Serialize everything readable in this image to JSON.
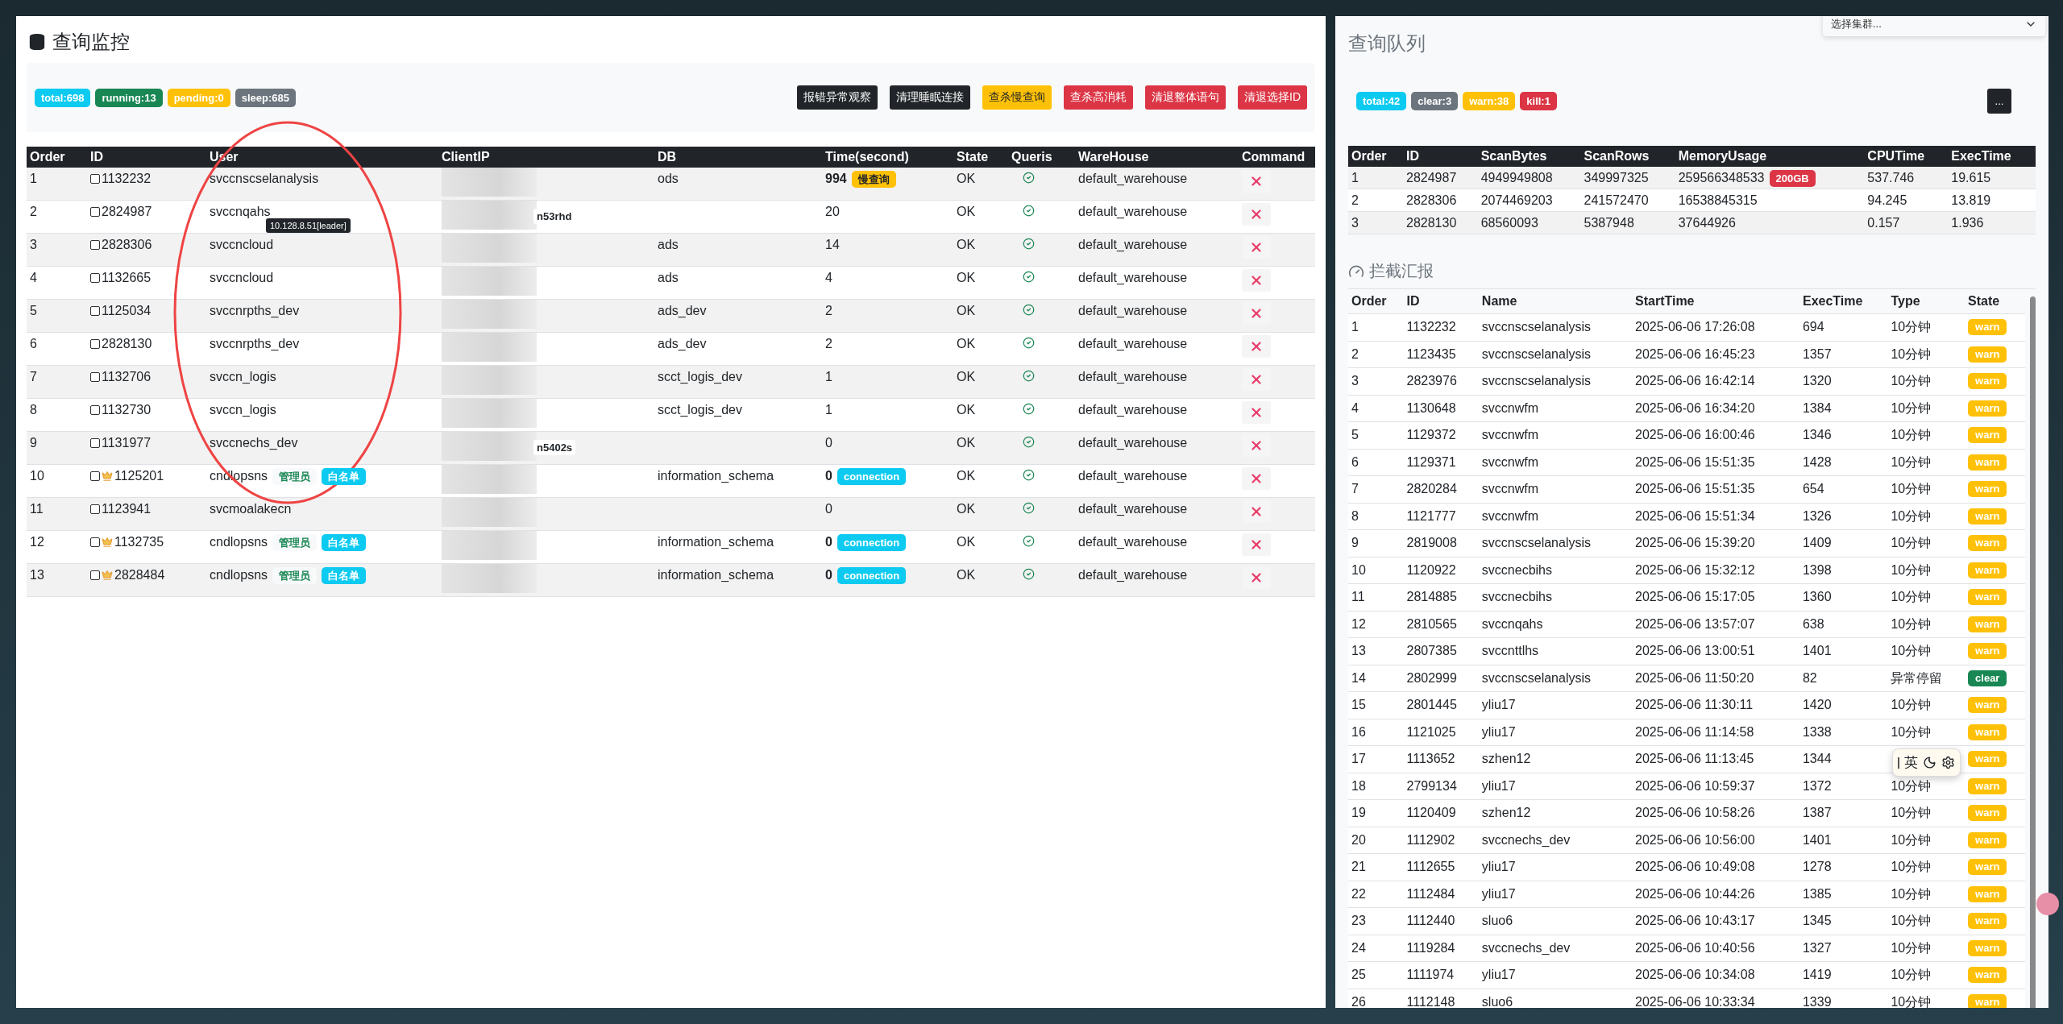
{
  "cluster_select": {
    "placeholder": "选择集群..."
  },
  "monitor": {
    "title": "查询监控",
    "stats": [
      {
        "label": "total:698",
        "kind": "info"
      },
      {
        "label": "running:13",
        "kind": "success"
      },
      {
        "label": "pending:0",
        "kind": "warning"
      },
      {
        "label": "sleep:685",
        "kind": "secondary"
      }
    ],
    "actions": [
      {
        "label": "报错异常观察",
        "kind": "dark"
      },
      {
        "label": "清理睡眠连接",
        "kind": "dark"
      },
      {
        "label": "查杀慢查询",
        "kind": "warning"
      },
      {
        "label": "查杀高消耗",
        "kind": "danger"
      },
      {
        "label": "清退整体语句",
        "kind": "danger"
      },
      {
        "label": "清退选择ID",
        "kind": "danger"
      }
    ],
    "columns": [
      "Order",
      "ID",
      "User",
      "ClientIP",
      "DB",
      "Time(second)",
      "State",
      "Queris",
      "WareHouse",
      "Command"
    ],
    "rows": [
      {
        "order": "1",
        "id": "1132232",
        "checked": false,
        "vip": false,
        "user": "svccnscselanalysis",
        "ip_fragment": null,
        "db": "ods",
        "time": "994",
        "time_tag": {
          "label": "慢查询",
          "kind": "warning"
        },
        "state": "OK",
        "warehouse": "default_warehouse"
      },
      {
        "order": "2",
        "id": "2824987",
        "checked": false,
        "vip": false,
        "user": "svccnqahs",
        "tooltip": "10.128.8.51[leader]",
        "ip_fragment": "n53rhd",
        "db": "",
        "time": "20",
        "state": "OK",
        "warehouse": "default_warehouse"
      },
      {
        "order": "3",
        "id": "2828306",
        "checked": false,
        "vip": false,
        "user": "svccncloud",
        "db": "ads",
        "time": "14",
        "state": "OK",
        "warehouse": "default_warehouse"
      },
      {
        "order": "4",
        "id": "1132665",
        "checked": false,
        "vip": false,
        "user": "svccncloud",
        "db": "ads",
        "time": "4",
        "state": "OK",
        "warehouse": "default_warehouse"
      },
      {
        "order": "5",
        "id": "1125034",
        "checked": false,
        "vip": false,
        "user": "svccnrpths_dev",
        "db": "ads_dev",
        "time": "2",
        "state": "OK",
        "warehouse": "default_warehouse"
      },
      {
        "order": "6",
        "id": "2828130",
        "checked": false,
        "vip": false,
        "user": "svccnrpths_dev",
        "db": "ads_dev",
        "time": "2",
        "state": "OK",
        "warehouse": "default_warehouse"
      },
      {
        "order": "7",
        "id": "1132706",
        "checked": false,
        "vip": false,
        "user": "svccn_logis",
        "db": "scct_logis_dev",
        "time": "1",
        "state": "OK",
        "warehouse": "default_warehouse"
      },
      {
        "order": "8",
        "id": "1132730",
        "checked": false,
        "vip": false,
        "user": "svccn_logis",
        "db": "scct_logis_dev",
        "time": "1",
        "state": "OK",
        "warehouse": "default_warehouse"
      },
      {
        "order": "9",
        "id": "1131977",
        "checked": false,
        "vip": false,
        "user": "svccnechs_dev",
        "ip_fragment": "n5402s",
        "db": "",
        "time": "0",
        "state": "OK",
        "warehouse": "default_warehouse"
      },
      {
        "order": "10",
        "id": "1125201",
        "checked": false,
        "vip": true,
        "user": "cndlopsns",
        "tags": [
          {
            "label": "管理员",
            "kind": "light"
          },
          {
            "label": "白名单",
            "kind": "info"
          }
        ],
        "db": "information_schema",
        "time": "0",
        "time_tag": {
          "label": "connection",
          "kind": "info"
        },
        "state": "OK",
        "warehouse": "default_warehouse"
      },
      {
        "order": "11",
        "id": "1123941",
        "checked": false,
        "vip": false,
        "user": "svcmoalakecn",
        "db": "",
        "time": "0",
        "state": "OK",
        "warehouse": "default_warehouse"
      },
      {
        "order": "12",
        "id": "1132735",
        "checked": false,
        "vip": true,
        "user": "cndlopsns",
        "tags": [
          {
            "label": "管理员",
            "kind": "light"
          },
          {
            "label": "白名单",
            "kind": "info"
          }
        ],
        "db": "information_schema",
        "time": "0",
        "time_tag": {
          "label": "connection",
          "kind": "info"
        },
        "state": "OK",
        "warehouse": "default_warehouse"
      },
      {
        "order": "13",
        "id": "2828484",
        "checked": false,
        "vip": true,
        "user": "cndlopsns",
        "tags": [
          {
            "label": "管理员",
            "kind": "light"
          },
          {
            "label": "白名单",
            "kind": "info"
          }
        ],
        "db": "information_schema",
        "time": "0",
        "time_tag": {
          "label": "connection",
          "kind": "info"
        },
        "state": "OK",
        "warehouse": "default_warehouse"
      }
    ]
  },
  "queue": {
    "title": "查询队列",
    "stats": [
      {
        "label": "total:42",
        "kind": "info"
      },
      {
        "label": "clear:3",
        "kind": "secondary"
      },
      {
        "label": "warn:38",
        "kind": "warning"
      },
      {
        "label": "kill:1",
        "kind": "danger"
      }
    ],
    "more_button": "...",
    "columns": [
      "Order",
      "ID",
      "ScanBytes",
      "ScanRows",
      "MemoryUsage",
      "CPUTime",
      "ExecTime"
    ],
    "rows": [
      {
        "cells": [
          "1",
          "2824987",
          "4949949808",
          "349997325",
          "259566348533",
          "537.746",
          "19.615"
        ],
        "memory_tag": "200GB"
      },
      {
        "cells": [
          "2",
          "2828306",
          "2074469203",
          "241572470",
          "16538845315",
          "94.245",
          "13.819"
        ]
      },
      {
        "cells": [
          "3",
          "2828130",
          "68560093",
          "5387948",
          "37644926",
          "0.157",
          "1.936"
        ]
      }
    ]
  },
  "intercept": {
    "title": "拦截汇报",
    "columns": [
      "Order",
      "ID",
      "Name",
      "StartTime",
      "ExecTime",
      "Type",
      "State"
    ],
    "rows": [
      {
        "cells": [
          "1",
          "1132232",
          "svccnscselanalysis",
          "2025-06-06 17:26:08",
          "694",
          "10分钟"
        ],
        "state": {
          "label": "warn",
          "kind": "warning"
        }
      },
      {
        "cells": [
          "2",
          "1123435",
          "svccnscselanalysis",
          "2025-06-06 16:45:23",
          "1357",
          "10分钟"
        ],
        "state": {
          "label": "warn",
          "kind": "warning"
        }
      },
      {
        "cells": [
          "3",
          "2823976",
          "svccnscselanalysis",
          "2025-06-06 16:42:14",
          "1320",
          "10分钟"
        ],
        "state": {
          "label": "warn",
          "kind": "warning"
        }
      },
      {
        "cells": [
          "4",
          "1130648",
          "svccnwfm",
          "2025-06-06 16:34:20",
          "1384",
          "10分钟"
        ],
        "state": {
          "label": "warn",
          "kind": "warning"
        }
      },
      {
        "cells": [
          "5",
          "1129372",
          "svccnwfm",
          "2025-06-06 16:00:46",
          "1346",
          "10分钟"
        ],
        "state": {
          "label": "warn",
          "kind": "warning"
        }
      },
      {
        "cells": [
          "6",
          "1129371",
          "svccnwfm",
          "2025-06-06 15:51:35",
          "1428",
          "10分钟"
        ],
        "state": {
          "label": "warn",
          "kind": "warning"
        }
      },
      {
        "cells": [
          "7",
          "2820284",
          "svccnwfm",
          "2025-06-06 15:51:35",
          "654",
          "10分钟"
        ],
        "state": {
          "label": "warn",
          "kind": "warning"
        }
      },
      {
        "cells": [
          "8",
          "1121777",
          "svccnwfm",
          "2025-06-06 15:51:34",
          "1326",
          "10分钟"
        ],
        "state": {
          "label": "warn",
          "kind": "warning"
        }
      },
      {
        "cells": [
          "9",
          "2819008",
          "svccnscselanalysis",
          "2025-06-06 15:39:20",
          "1409",
          "10分钟"
        ],
        "state": {
          "label": "warn",
          "kind": "warning"
        }
      },
      {
        "cells": [
          "10",
          "1120922",
          "svccnecbihs",
          "2025-06-06 15:32:12",
          "1398",
          "10分钟"
        ],
        "state": {
          "label": "warn",
          "kind": "warning"
        }
      },
      {
        "cells": [
          "11",
          "2814885",
          "svccnecbihs",
          "2025-06-06 15:17:05",
          "1360",
          "10分钟"
        ],
        "state": {
          "label": "warn",
          "kind": "warning"
        }
      },
      {
        "cells": [
          "12",
          "2810565",
          "svccnqahs",
          "2025-06-06 13:57:07",
          "638",
          "10分钟"
        ],
        "state": {
          "label": "warn",
          "kind": "warning"
        }
      },
      {
        "cells": [
          "13",
          "2807385",
          "svccnttlhs",
          "2025-06-06 13:00:51",
          "1401",
          "10分钟"
        ],
        "state": {
          "label": "warn",
          "kind": "warning"
        }
      },
      {
        "cells": [
          "14",
          "2802999",
          "svccnscselanalysis",
          "2025-06-06 11:50:20",
          "82",
          "异常停留"
        ],
        "state": {
          "label": "clear",
          "kind": "success"
        }
      },
      {
        "cells": [
          "15",
          "2801445",
          "yliu17",
          "2025-06-06 11:30:11",
          "1420",
          "10分钟"
        ],
        "state": {
          "label": "warn",
          "kind": "warning"
        }
      },
      {
        "cells": [
          "16",
          "1121025",
          "yliu17",
          "2025-06-06 11:14:58",
          "1338",
          "10分钟"
        ],
        "state": {
          "label": "warn",
          "kind": "warning"
        }
      },
      {
        "cells": [
          "17",
          "1113652",
          "szhen12",
          "2025-06-06 11:13:45",
          "1344",
          ""
        ],
        "state": {
          "label": "warn",
          "kind": "warning"
        }
      },
      {
        "cells": [
          "18",
          "2799134",
          "yliu17",
          "2025-06-06 10:59:37",
          "1372",
          "10分钟"
        ],
        "state": {
          "label": "warn",
          "kind": "warning"
        }
      },
      {
        "cells": [
          "19",
          "1120409",
          "szhen12",
          "2025-06-06 10:58:26",
          "1387",
          "10分钟"
        ],
        "state": {
          "label": "warn",
          "kind": "warning"
        }
      },
      {
        "cells": [
          "20",
          "1112902",
          "svccnechs_dev",
          "2025-06-06 10:56:00",
          "1401",
          "10分钟"
        ],
        "state": {
          "label": "warn",
          "kind": "warning"
        }
      },
      {
        "cells": [
          "21",
          "1112655",
          "yliu17",
          "2025-06-06 10:49:08",
          "1278",
          "10分钟"
        ],
        "state": {
          "label": "warn",
          "kind": "warning"
        }
      },
      {
        "cells": [
          "22",
          "1112484",
          "yliu17",
          "2025-06-06 10:44:26",
          "1385",
          "10分钟"
        ],
        "state": {
          "label": "warn",
          "kind": "warning"
        }
      },
      {
        "cells": [
          "23",
          "1112440",
          "sluo6",
          "2025-06-06 10:43:17",
          "1345",
          "10分钟"
        ],
        "state": {
          "label": "warn",
          "kind": "warning"
        }
      },
      {
        "cells": [
          "24",
          "1119284",
          "svccnechs_dev",
          "2025-06-06 10:40:56",
          "1327",
          "10分钟"
        ],
        "state": {
          "label": "warn",
          "kind": "warning"
        }
      },
      {
        "cells": [
          "25",
          "1111974",
          "yliu17",
          "2025-06-06 10:34:08",
          "1419",
          "10分钟"
        ],
        "state": {
          "label": "warn",
          "kind": "warning"
        }
      },
      {
        "cells": [
          "26",
          "1112148",
          "sluo6",
          "2025-06-06 10:33:34",
          "1339",
          "10分钟"
        ],
        "state": {
          "label": "warn",
          "kind": "warning"
        }
      }
    ]
  },
  "ime_toolbar": {
    "label": "英"
  }
}
